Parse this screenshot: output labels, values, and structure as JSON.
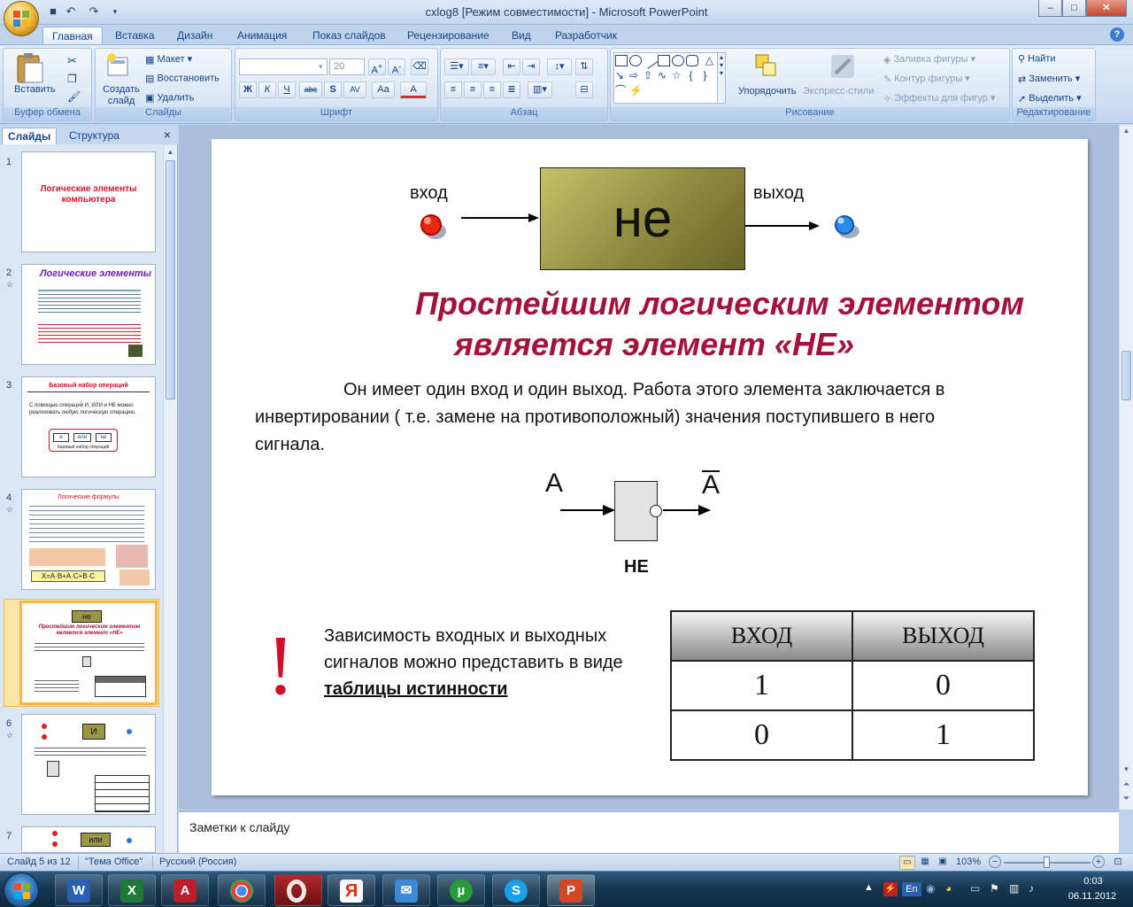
{
  "window": {
    "title": "cxlog8 [Режим совместимости] - Microsoft PowerPoint",
    "controls": {
      "minimize": "–",
      "maximize": "□",
      "close": "✕"
    }
  },
  "quick_access": [
    "save-icon",
    "undo-icon",
    "redo-icon"
  ],
  "ribbon_tabs": [
    "Главная",
    "Вставка",
    "Дизайн",
    "Анимация",
    "Показ слайдов",
    "Рецензирование",
    "Вид",
    "Разработчик"
  ],
  "ribbon": {
    "clipboard": {
      "paste": "Вставить",
      "label": "Буфер обмена"
    },
    "slides": {
      "create": "Создать слайд",
      "layout": "Макет",
      "reset": "Восстановить",
      "delete": "Удалить",
      "label": "Слайды"
    },
    "font": {
      "font_name": "",
      "font_size": "20",
      "label": "Шрифт",
      "buttons": [
        "Ж",
        "К",
        "Ч",
        "abc",
        "S",
        "AV",
        "Aa",
        "A"
      ]
    },
    "paragraph": {
      "label": "Абзац"
    },
    "drawing": {
      "arrange": "Упорядочить",
      "quick_styles": "Экспресс-стили",
      "fill": "Заливка фигуры",
      "outline": "Контур фигуры",
      "effects": "Эффекты для фигур",
      "label": "Рисование"
    },
    "editing": {
      "find": "Найти",
      "replace": "Заменить",
      "select": "Выделить",
      "label": "Редактирование"
    }
  },
  "left_panel": {
    "tab_slides": "Слайды",
    "tab_outline": "Структура",
    "close": "×",
    "thumbnails": [
      {
        "num": "1",
        "title": "Логические элементы компьютера"
      },
      {
        "num": "2",
        "title": "Логические элементы"
      },
      {
        "num": "3",
        "title": "Базовый набор операций",
        "text": "С помощью операций И, ИЛИ и НЕ можно реализовать любую логическую операцию.",
        "items": [
          "и",
          "или",
          "не"
        ],
        "caption": "базовый набор операций"
      },
      {
        "num": "4",
        "title": "Логические формулы",
        "formula": "X=A·B+A·C+B·C"
      },
      {
        "num": "5",
        "title": "Простейшим логическим элементом является элемент «НЕ»",
        "gate": "не"
      },
      {
        "num": "6",
        "gate": "И"
      },
      {
        "num": "7",
        "gate": "или"
      }
    ]
  },
  "slide": {
    "gate": {
      "input_label": "вход",
      "output_label": "выход",
      "name": "не"
    },
    "heading_line1": "Простейшим логическим элементом",
    "heading_line2": "является элемент «НЕ»",
    "body": "Он имеет один  вход и один выход. Работа этого элемента заключается в инвертировании ( т.е. замене  на противоположный) значения поступившего в него сигнала.",
    "diagram": {
      "input": "A",
      "output": "A",
      "caption": "НЕ"
    },
    "exclamation": "!",
    "note_prefix": "Зависимость входных и выходных сигналов можно представить в виде ",
    "note_link": "таблицы истинности",
    "truth_table": {
      "headers": [
        "ВХОД",
        "ВЫХОД"
      ],
      "rows": [
        [
          "1",
          "0"
        ],
        [
          "0",
          "1"
        ]
      ]
    }
  },
  "notes_placeholder": "Заметки к слайду",
  "status_bar": {
    "slide_info": "Слайд 5 из 12",
    "theme": "\"Тема Office\"",
    "language": "Русский (Россия)",
    "zoom": "103%"
  },
  "taskbar": {
    "apps": [
      "Word",
      "Excel",
      "Acrobat",
      "Chrome",
      "Opera",
      "Яндекс",
      "Почта",
      "uTorrent",
      "Skype",
      "PowerPoint"
    ],
    "lang": "En",
    "time": "0:03",
    "date": "06.11.2012"
  },
  "colors": {
    "heading": "#a3123a",
    "gate_fill": "#8e8a3e",
    "accent_ribbon": "#15428b"
  }
}
